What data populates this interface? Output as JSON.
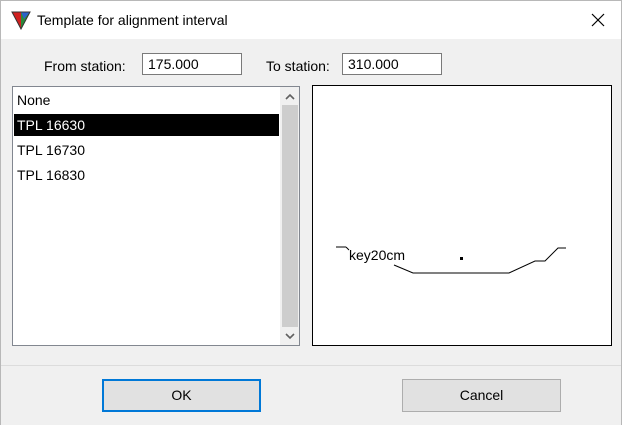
{
  "window": {
    "title": "Template for alignment interval"
  },
  "fields": {
    "from_label": "From station:",
    "from_value": "175.000",
    "to_label": "To station:",
    "to_value": "310.000"
  },
  "templates": {
    "items": [
      "None",
      "TPL 16630",
      "TPL 16730",
      "TPL 16830"
    ],
    "selected": "TPL 16630"
  },
  "preview": {
    "label": "key20cm"
  },
  "buttons": {
    "ok": "OK",
    "cancel": "Cancel"
  },
  "colors": {
    "accent": "#0078d7",
    "selection_bg": "#000000",
    "selection_fg": "#ffffff"
  },
  "icons": {
    "app": "template-app-icon",
    "close": "close-icon",
    "scroll_up": "chevron-up-icon",
    "scroll_down": "chevron-down-icon"
  }
}
